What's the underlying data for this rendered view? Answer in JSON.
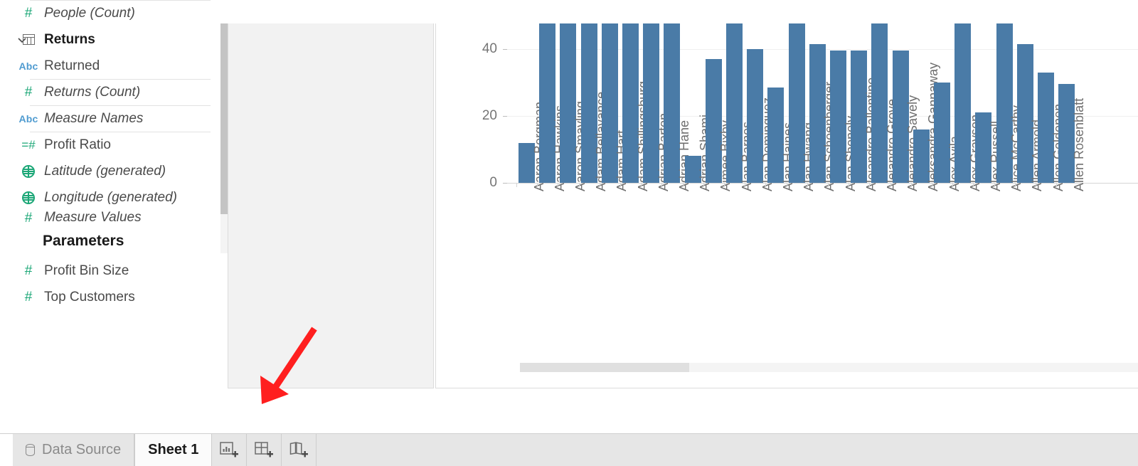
{
  "app": "Tableau Desktop",
  "data_pane": {
    "fields": [
      {
        "icon": "hash-icon",
        "icon_type": "hash",
        "label": "People (Count)",
        "style": "italic",
        "sep_above": true
      },
      {
        "icon": "table-icon",
        "icon_type": "table",
        "label": "Returns",
        "style": "bold",
        "caret": "chevron-down-icon"
      },
      {
        "icon": "abc-icon",
        "icon_type": "abc",
        "label": "Returned",
        "style": "normal"
      },
      {
        "icon": "hash-icon",
        "icon_type": "hash",
        "label": "Returns (Count)",
        "style": "italic",
        "sep_above": true
      },
      {
        "icon": "abc-icon",
        "icon_type": "abc",
        "label": "Measure Names",
        "style": "italic",
        "sep_above": true
      },
      {
        "icon": "calculated-field-icon",
        "icon_type": "calc",
        "label": "Profit Ratio",
        "style": "normal",
        "sep_above": true
      },
      {
        "icon": "globe-icon",
        "icon_type": "globe",
        "label": "Latitude (generated)",
        "style": "italic"
      },
      {
        "icon": "globe-icon",
        "icon_type": "globe",
        "label": "Longitude (generated)",
        "style": "italic"
      },
      {
        "icon": "hash-icon",
        "icon_type": "hash",
        "label": "Measure Values",
        "style": "italic",
        "clipped": true
      }
    ],
    "parameters_header": "Parameters",
    "parameters": [
      {
        "icon": "hash-icon",
        "label": "Profit Bin Size"
      },
      {
        "icon": "hash-icon",
        "label": "Top Customers"
      }
    ]
  },
  "tabbar": {
    "data_source_label": "Data Source",
    "sheet_tab_label": "Sheet 1",
    "buttons": [
      {
        "name": "new-worksheet-button",
        "title": "New Worksheet"
      },
      {
        "name": "new-dashboard-button",
        "title": "New Dashboard"
      },
      {
        "name": "new-story-button",
        "title": "New Story"
      }
    ]
  },
  "annotation": {
    "type": "red-arrow",
    "points_to": "new-dashboard-button",
    "color": "#ff1f1f"
  },
  "colors": {
    "bar": "#4a7ba7",
    "arrow": "#ff1f1f",
    "tabbar_bg": "#e6e6e6",
    "shelf_bg": "#f2f2f2",
    "grid": "#f0f0f0",
    "green_icon": "#1ca777",
    "blue_icon": "#4f9bd0"
  },
  "chart_data": {
    "type": "bar",
    "title": "",
    "xlabel": "",
    "ylabel": "",
    "ylim": [
      0,
      48
    ],
    "yticks": [
      0,
      20,
      40
    ],
    "grid": true,
    "legend": "none",
    "truncated_right": true,
    "categories": [
      "Aaron Bergman",
      "Aaron Hawkins",
      "Aaron Smayling",
      "Adam Bellavance",
      "Adam Hart",
      "Adam Shillingsburg",
      "Adrian Barton",
      "Adrian Hane",
      "Adrian Shami",
      "Aimee Bixby",
      "Alan Barnes",
      "Alan Dominguez",
      "Alan Haines",
      "Alan Hwang",
      "Alan Schoenberger",
      "Alan Shonely",
      "Alejandro Ballentine",
      "Alejandro Grove",
      "Alejandro Savely",
      "Aleksandra Gannaway",
      "Alex Avila",
      "Alex Grayson",
      "Alex Russell",
      "Alice McCarthy",
      "Allen Armold",
      "Allen Goldenen",
      "Allen Rosenblatt"
    ],
    "values": [
      12,
      48,
      48,
      48,
      48,
      48,
      48,
      48,
      8,
      37,
      48,
      40,
      28.5,
      48,
      41.5,
      39.5,
      39.5,
      48,
      39.5,
      16,
      30,
      48,
      21,
      48,
      41.5,
      33,
      29.5
    ]
  }
}
